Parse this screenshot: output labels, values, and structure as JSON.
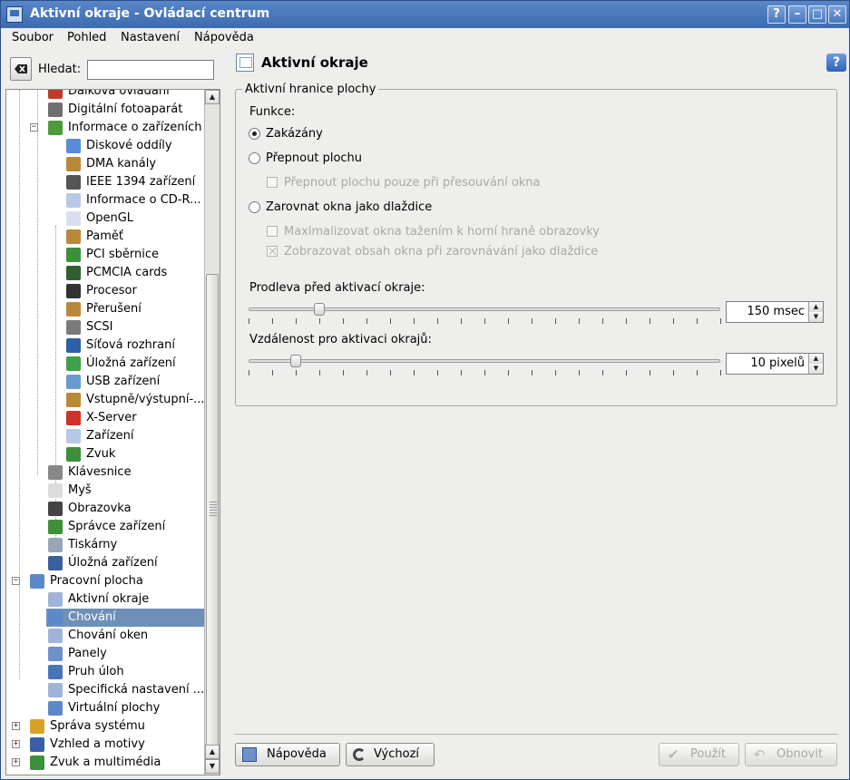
{
  "window": {
    "title": "Aktivní okraje - Ovládací centrum",
    "controls": [
      "?",
      "–",
      "□",
      "✕"
    ]
  },
  "menu": [
    "Soubor",
    "Pohled",
    "Nastavení",
    "Nápověda"
  ],
  "search": {
    "label": "Hledat:",
    "value": ""
  },
  "tree": {
    "items": [
      {
        "label": "Dálková ovládání",
        "icon": "remote-control-icon",
        "level": 1,
        "color": "#c0392b"
      },
      {
        "label": "Digitální fotoaparát",
        "icon": "camera-icon",
        "level": 1,
        "color": "#6f6f6f"
      },
      {
        "label": "Informace o zařízeních",
        "icon": "device-info-icon",
        "level": 1,
        "color": "#4f9a3c",
        "expander": "−"
      },
      {
        "label": "Diskové oddíly",
        "icon": "disk-partition-icon",
        "level": 2,
        "color": "#5a8bd6"
      },
      {
        "label": "DMA kanály",
        "icon": "dma-icon",
        "level": 2,
        "color": "#b9893a"
      },
      {
        "label": "IEEE 1394 zařízení",
        "icon": "ieee1394-icon",
        "level": 2,
        "color": "#555555"
      },
      {
        "label": "Informace o CD-R...",
        "icon": "cdrom-icon",
        "level": 2,
        "color": "#b8c8e8"
      },
      {
        "label": "OpenGL",
        "icon": "opengl-icon",
        "level": 2,
        "color": "#d8e0f0"
      },
      {
        "label": "Paměť",
        "icon": "memory-icon",
        "level": 2,
        "color": "#b9893a"
      },
      {
        "label": "PCI sběrnice",
        "icon": "pci-icon",
        "level": 2,
        "color": "#3e8f3a"
      },
      {
        "label": "PCMCIA cards",
        "icon": "pcmcia-icon",
        "level": 2,
        "color": "#2f5f2f"
      },
      {
        "label": "Procesor",
        "icon": "processor-icon",
        "level": 2,
        "color": "#333333"
      },
      {
        "label": "Přerušení",
        "icon": "interrupt-icon",
        "level": 2,
        "color": "#b9893a"
      },
      {
        "label": "SCSI",
        "icon": "scsi-icon",
        "level": 2,
        "color": "#7a7a7a"
      },
      {
        "label": "Síťová rozhraní",
        "icon": "network-icon",
        "level": 2,
        "color": "#2f5fa8"
      },
      {
        "label": "Úložná zařízení",
        "icon": "storage-icon",
        "level": 2,
        "color": "#3fa04a"
      },
      {
        "label": "USB zařízení",
        "icon": "usb-icon",
        "level": 2,
        "color": "#6a9bd0"
      },
      {
        "label": "Vstupně/výstupní-...",
        "icon": "io-ports-icon",
        "level": 2,
        "color": "#b9893a"
      },
      {
        "label": "X-Server",
        "icon": "x-server-icon",
        "level": 2,
        "color": "#d0302a"
      },
      {
        "label": "Zařízení",
        "icon": "devices-icon",
        "level": 2,
        "color": "#b8c8e8"
      },
      {
        "label": "Zvuk",
        "icon": "sound-icon",
        "level": 2,
        "color": "#3e8f3a"
      },
      {
        "label": "Klávesnice",
        "icon": "keyboard-icon",
        "level": 1,
        "color": "#888888"
      },
      {
        "label": "Myš",
        "icon": "mouse-icon",
        "level": 1,
        "color": "#dddddd"
      },
      {
        "label": "Obrazovka",
        "icon": "display-icon",
        "level": 1,
        "color": "#444444"
      },
      {
        "label": "Správce zařízení",
        "icon": "device-manager-icon",
        "level": 1,
        "color": "#3e8f3a"
      },
      {
        "label": "Tiskárny",
        "icon": "printer-icon",
        "level": 1,
        "color": "#9aa6b8"
      },
      {
        "label": "Úložná zařízení",
        "icon": "storage-media-icon",
        "level": 1,
        "color": "#3b5f9a"
      },
      {
        "label": "Pracovní plocha",
        "icon": "desktop-icon",
        "level": 0,
        "color": "#5b88c9",
        "expander": "−"
      },
      {
        "label": "Aktivní okraje",
        "icon": "active-edges-icon",
        "level": 1,
        "color": "#9fb4d6"
      },
      {
        "label": "Chování",
        "icon": "behavior-icon",
        "level": 1,
        "color": "#5b88c9",
        "selected": true
      },
      {
        "label": "Chování oken",
        "icon": "window-behavior-icon",
        "level": 1,
        "color": "#9fb4d6"
      },
      {
        "label": "Panely",
        "icon": "panels-icon",
        "level": 1,
        "color": "#6f90c8"
      },
      {
        "label": "Pruh úloh",
        "icon": "taskbar-icon",
        "level": 1,
        "color": "#4a74b8"
      },
      {
        "label": "Specifická nastavení ...",
        "icon": "window-specific-icon",
        "level": 1,
        "color": "#9fb4d6"
      },
      {
        "label": "Virtuální plochy",
        "icon": "virtual-desktops-icon",
        "level": 1,
        "color": "#5b88c9"
      },
      {
        "label": "Správa systému",
        "icon": "system-admin-icon",
        "level": 0,
        "color": "#d8a22a",
        "expander": "+"
      },
      {
        "label": "Vzhled a motivy",
        "icon": "appearance-icon",
        "level": 0,
        "color": "#3a5fa8",
        "expander": "+"
      },
      {
        "label": "Zvuk a multimédia",
        "icon": "multimedia-icon",
        "level": 0,
        "color": "#3e8f3a",
        "expander": "+"
      }
    ]
  },
  "module": {
    "title": "Aktivní okraje",
    "help_icon": "?",
    "group_title": "Aktivní hranice plochy",
    "function_label": "Funkce:",
    "options": {
      "disabled": "Zakázány",
      "switch_desktop": "Přepnout plochu",
      "switch_only_when_moving": "Přepnout plochu pouze při přesouvání okna",
      "tile_windows": "Zarovnat okna jako dlaždice",
      "maximize_top": "Maximalizovat okna tažením k horní hraně obrazovky",
      "show_content_tiling": "Zobrazovat obsah okna při zarovnávání jako dlaždice"
    },
    "selected_option": "disabled",
    "delay": {
      "label": "Prodleva před aktivací okraje:",
      "value": "150 msec",
      "level": 0.15
    },
    "distance": {
      "label": "Vzdálenost pro aktivaci okrajů:",
      "value": "10 pixelů",
      "level": 0.1
    }
  },
  "buttons": {
    "help": "Nápověda",
    "defaults": "Výchozí",
    "apply": "Použít",
    "reset": "Obnovit"
  }
}
